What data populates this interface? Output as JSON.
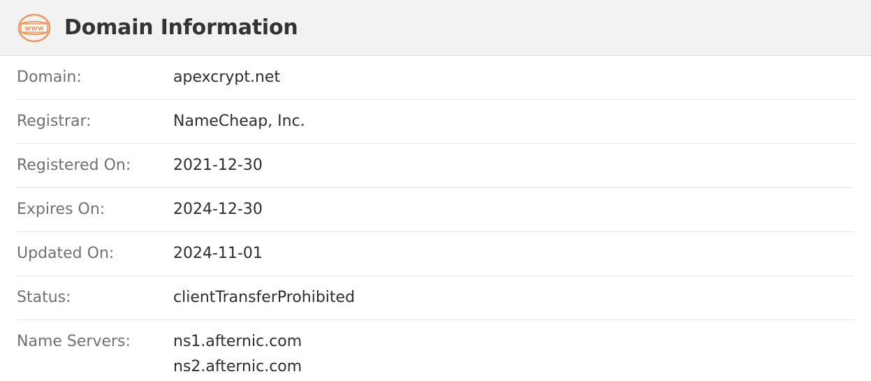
{
  "header": {
    "title": "Domain Information",
    "icon": "www-icon",
    "icon_text": "www",
    "accent_color": "#f0965a"
  },
  "rows": [
    {
      "label": "Domain:",
      "value": "apexcrypt.net"
    },
    {
      "label": "Registrar:",
      "value": "NameCheap, Inc."
    },
    {
      "label": "Registered On:",
      "value": "2021-12-30"
    },
    {
      "label": "Expires On:",
      "value": "2024-12-30"
    },
    {
      "label": "Updated On:",
      "value": "2024-11-01"
    },
    {
      "label": "Status:",
      "value": "clientTransferProhibited"
    }
  ],
  "name_servers": {
    "label": "Name Servers:",
    "values": [
      "ns1.afternic.com",
      "ns2.afternic.com"
    ]
  }
}
